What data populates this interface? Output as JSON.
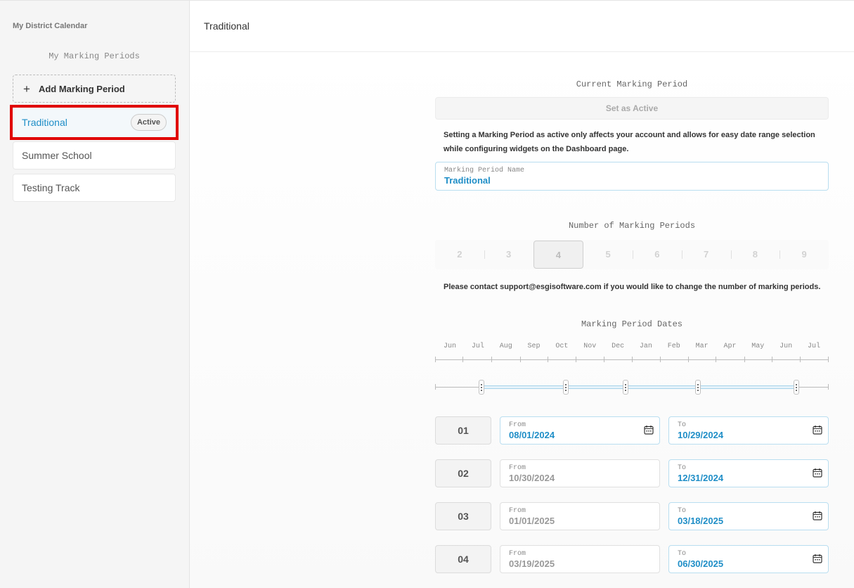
{
  "sidebar": {
    "title": "My District Calendar",
    "subtitle": "My Marking Periods",
    "add_label": "Add Marking Period",
    "items": [
      {
        "label": "Traditional",
        "badge": "Active"
      },
      {
        "label": "Summer School"
      },
      {
        "label": "Testing Track"
      }
    ]
  },
  "header": {
    "title": "Traditional"
  },
  "current": {
    "title": "Current Marking Period",
    "set_active_label": "Set as Active",
    "note": "Setting a Marking Period as active only affects your account and allows for easy date range selection while configuring widgets on the Dashboard page.",
    "name_label": "Marking Period Name",
    "name_value": "Traditional"
  },
  "number_of_periods": {
    "title": "Number of Marking Periods",
    "options": [
      "2",
      "3",
      "4",
      "5",
      "6",
      "7",
      "8",
      "9"
    ],
    "selected": "4",
    "note": "Please contact support@esgisoftware.com if you would like to change the number of marking periods."
  },
  "dates": {
    "title": "Marking Period Dates",
    "months": [
      "Jun",
      "Jul",
      "Aug",
      "Sep",
      "Oct",
      "Nov",
      "Dec",
      "Jan",
      "Feb",
      "Mar",
      "Apr",
      "May",
      "Jun",
      "Jul"
    ],
    "from_label": "From",
    "to_label": "To",
    "periods": [
      {
        "num": "01",
        "from": "08/01/2024",
        "to": "10/29/2024"
      },
      {
        "num": "02",
        "from": "10/30/2024",
        "to": "12/31/2024"
      },
      {
        "num": "03",
        "from": "01/01/2025",
        "to": "03/18/2025"
      },
      {
        "num": "04",
        "from": "03/19/2025",
        "to": "06/30/2025"
      }
    ]
  },
  "colors": {
    "accent": "#1f8ec7",
    "highlight": "#e00000"
  }
}
